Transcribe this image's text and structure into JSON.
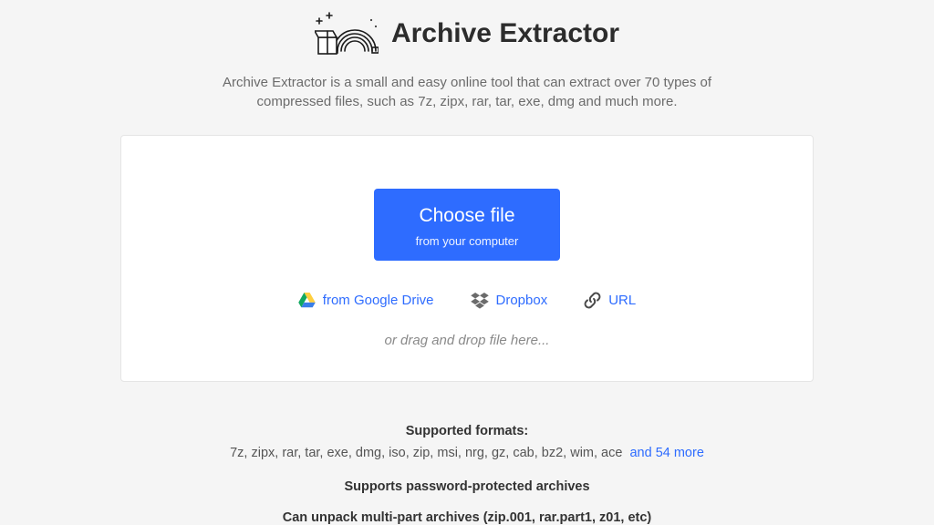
{
  "header": {
    "title": "Archive Extractor",
    "subtitle": "Archive Extractor is a small and easy online tool that can extract over 70 types of compressed files, such as 7z, zipx, rar, tar, exe, dmg and much more."
  },
  "upload": {
    "choose_label": "Choose file",
    "choose_sub": "from your computer",
    "gdrive_label": "from Google Drive",
    "dropbox_label": "Dropbox",
    "url_label": "URL",
    "drag_hint": "or drag and drop file here..."
  },
  "formats": {
    "title": "Supported formats:",
    "list": "7z, zipx, rar, tar, exe, dmg, iso, zip, msi, nrg, gz, cab, bz2, wim, ace",
    "more": "and 54 more"
  },
  "features": {
    "password": "Supports password-protected archives",
    "multipart": "Can unpack multi-part archives (zip.001, rar.part1, z01, etc)"
  },
  "icons": {
    "rainbow": "rainbow-box-icon",
    "gdrive": "google-drive-icon",
    "dropbox": "dropbox-icon",
    "link": "link-icon"
  }
}
